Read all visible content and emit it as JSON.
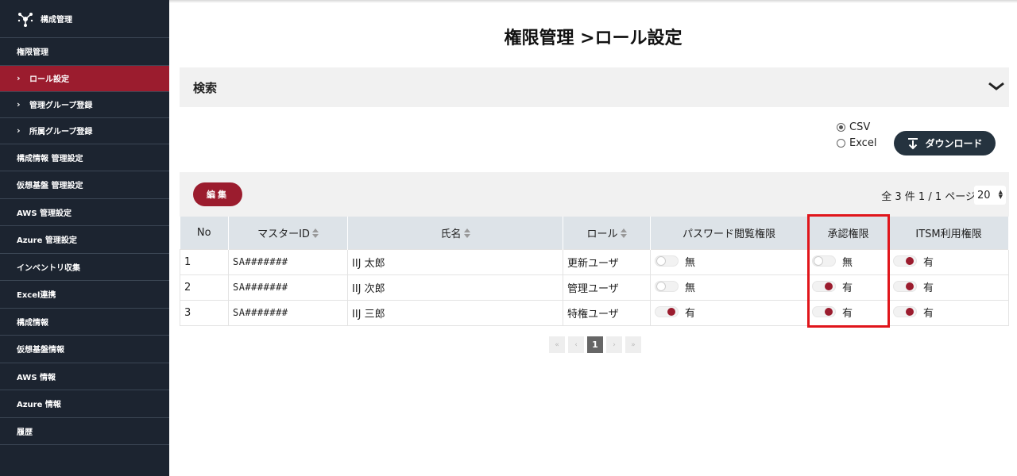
{
  "sidebar": {
    "brand": "構成管理",
    "items": [
      {
        "label": "権限管理",
        "sub": false,
        "active": false
      },
      {
        "label": "ロール設定",
        "sub": true,
        "active": true
      },
      {
        "label": "管理グループ登録",
        "sub": true,
        "active": false
      },
      {
        "label": "所属グループ登録",
        "sub": true,
        "active": false
      },
      {
        "label": "構成情報 管理設定",
        "sub": false,
        "active": false
      },
      {
        "label": "仮想基盤 管理設定",
        "sub": false,
        "active": false
      },
      {
        "label": "AWS 管理設定",
        "sub": false,
        "active": false
      },
      {
        "label": "Azure 管理設定",
        "sub": false,
        "active": false
      },
      {
        "label": "インベントリ収集",
        "sub": false,
        "active": false
      },
      {
        "label": "Excel連携",
        "sub": false,
        "active": false
      },
      {
        "label": "構成情報",
        "sub": false,
        "active": false
      },
      {
        "label": "仮想基盤情報",
        "sub": false,
        "active": false
      },
      {
        "label": "AWS 情報",
        "sub": false,
        "active": false
      },
      {
        "label": "Azure 情報",
        "sub": false,
        "active": false
      },
      {
        "label": "履歴",
        "sub": false,
        "active": false
      }
    ]
  },
  "page": {
    "title": "権限管理 >ロール設定",
    "search_label": "検索"
  },
  "export": {
    "options": [
      "CSV",
      "Excel"
    ],
    "selected": "CSV",
    "download_label": "ダウンロード"
  },
  "toolbar": {
    "edit_label": "編集",
    "page_info": "全 3 件 1 /  1 ページ",
    "page_size": "20"
  },
  "table": {
    "headers": [
      "No",
      "マスターID",
      "氏名",
      "ロール",
      "パスワード閲覧権限",
      "承認権限",
      "ITSM利用権限"
    ],
    "rows": [
      {
        "no": "1",
        "id": "SA#######",
        "name": "IIJ 太郎",
        "role": "更新ユーザ",
        "pw": "無",
        "approve": "無",
        "itsm": "有"
      },
      {
        "no": "2",
        "id": "SA#######",
        "name": "IIJ 次郎",
        "role": "管理ユーザ",
        "pw": "無",
        "approve": "有",
        "itsm": "有"
      },
      {
        "no": "3",
        "id": "SA#######",
        "name": "IIJ 三郎",
        "role": "特権ユーザ",
        "pw": "有",
        "approve": "有",
        "itsm": "有"
      }
    ]
  },
  "pager": {
    "current": "1"
  },
  "colors": {
    "sidebar_bg": "#1c2430",
    "accent": "#9b1c2e",
    "highlight": "#e0151b"
  }
}
